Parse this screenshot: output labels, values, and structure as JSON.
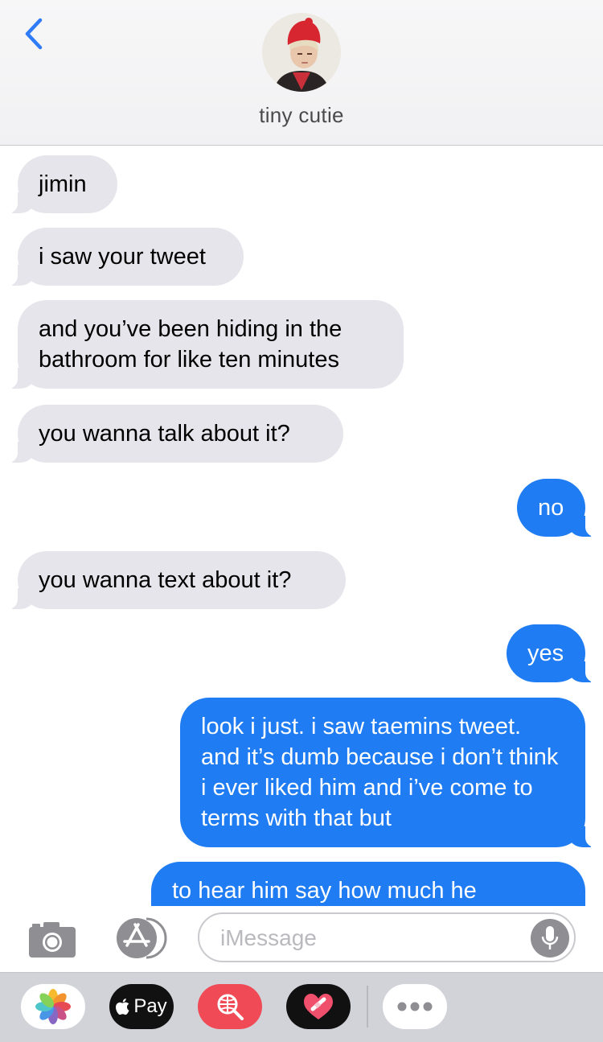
{
  "header": {
    "back_icon": "chevron-left-icon",
    "contact_name": "tiny cutie",
    "accent_color": "#2f7cf6"
  },
  "messages": [
    {
      "direction": "incoming",
      "text": "jimin"
    },
    {
      "direction": "incoming",
      "text": "i saw your tweet"
    },
    {
      "direction": "incoming",
      "text": "and you’ve been hiding in the bathroom for like ten minutes"
    },
    {
      "direction": "incoming",
      "text": "you wanna talk about it?"
    },
    {
      "direction": "outgoing",
      "text": "no"
    },
    {
      "direction": "incoming",
      "text": "you wanna text about it?"
    },
    {
      "direction": "outgoing",
      "text": "yes"
    },
    {
      "direction": "outgoing",
      "text": "look i just. i saw taemins tweet. and it’s dumb because i don’t think i ever liked him and i’ve come to terms with that but"
    },
    {
      "direction": "outgoing",
      "text": "to hear him say how much he"
    }
  ],
  "input_bar": {
    "camera_icon": "camera-icon",
    "appstore_icon": "app-store-icon",
    "placeholder": "iMessage",
    "mic_icon": "microphone-icon"
  },
  "app_drawer": {
    "items": [
      {
        "name": "photos-icon"
      },
      {
        "name": "apple-pay-icon",
        "label": "Pay"
      },
      {
        "name": "web-search-icon"
      },
      {
        "name": "digital-touch-icon"
      },
      {
        "name": "more-apps-icon"
      }
    ]
  },
  "colors": {
    "incoming_bubble": "#e6e5eb",
    "outgoing_bubble": "#1f7cf2"
  }
}
